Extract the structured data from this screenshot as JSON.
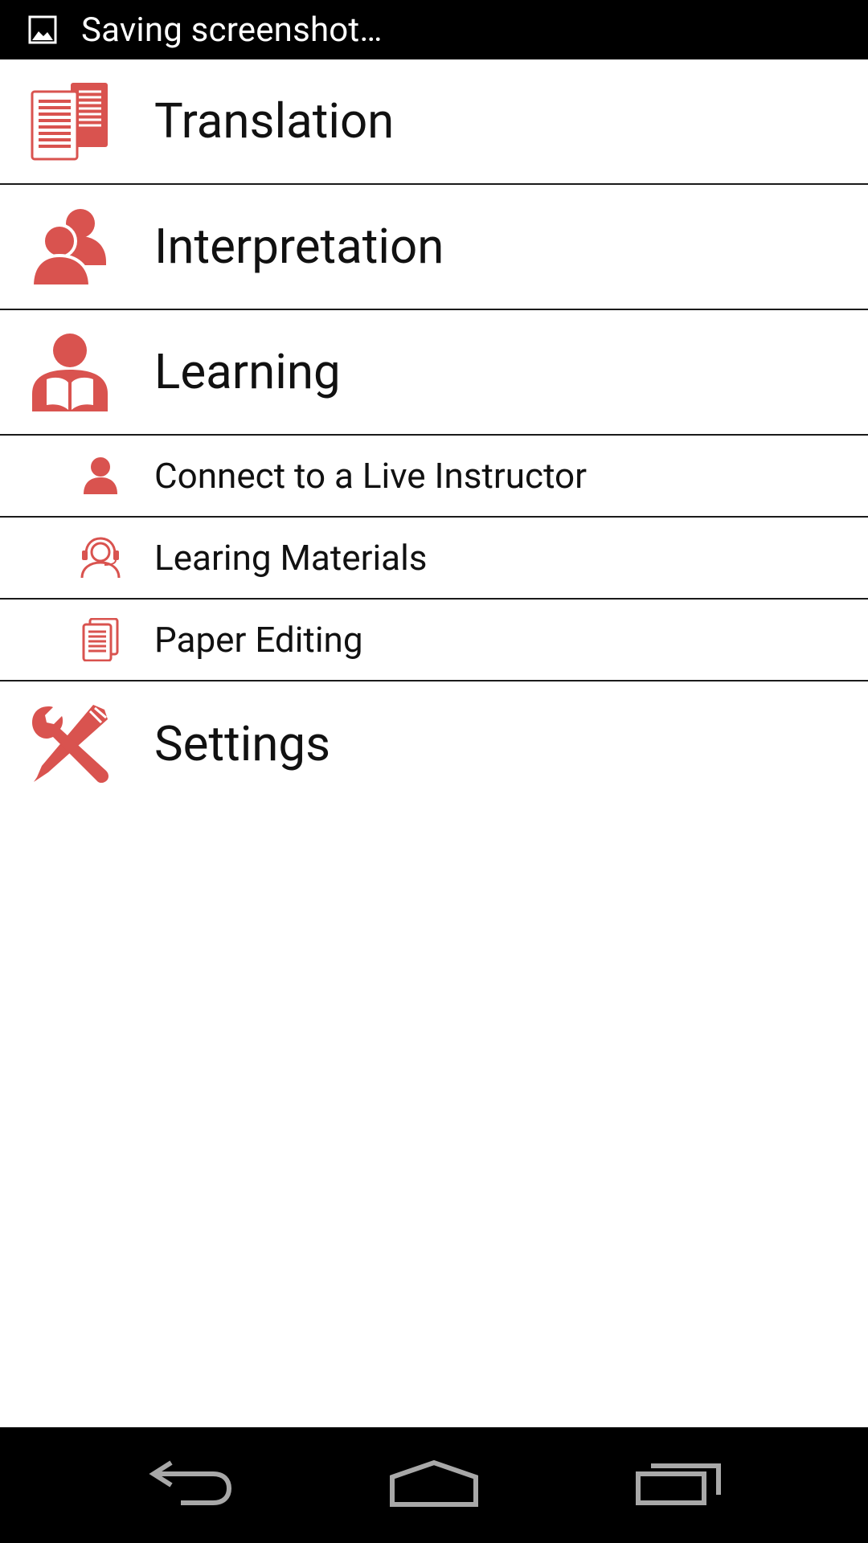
{
  "status_bar": {
    "icon": "image-icon",
    "text": "Saving screenshot…"
  },
  "menu": {
    "accent_color": "#d9534f",
    "items": [
      {
        "label": "Translation",
        "icon": "documents-icon",
        "size": "big"
      },
      {
        "label": "Interpretation",
        "icon": "people-icon",
        "size": "big"
      },
      {
        "label": "Learning",
        "icon": "person-reading-icon",
        "size": "big"
      },
      {
        "label": "Connect to a Live Instructor",
        "icon": "person-icon",
        "size": "small"
      },
      {
        "label": "Learing Materials",
        "icon": "headset-icon",
        "size": "small"
      },
      {
        "label": "Paper Editing",
        "icon": "document-icon",
        "size": "small"
      },
      {
        "label": "Settings",
        "icon": "tools-icon",
        "size": "big"
      }
    ]
  },
  "nav_bar": {
    "back_icon": "back-icon",
    "home_icon": "home-icon",
    "recents_icon": "recent-apps-icon"
  }
}
